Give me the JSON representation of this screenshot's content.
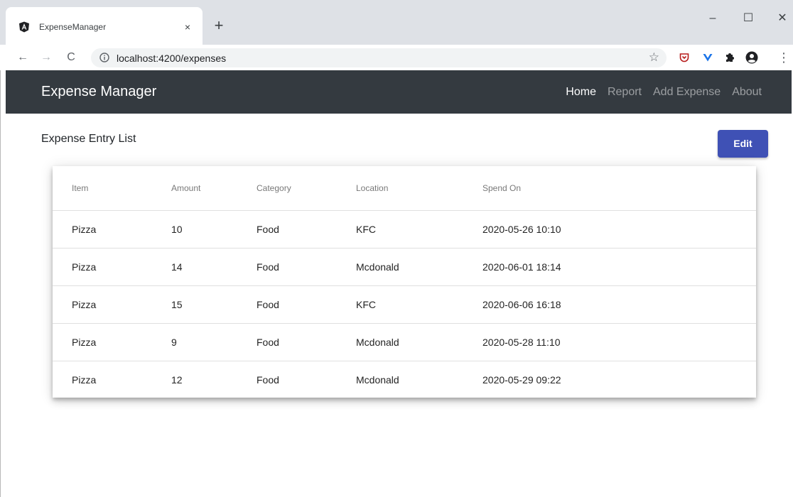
{
  "browser": {
    "tab_title": "ExpenseManager",
    "tab_close_glyph": "×",
    "new_tab_glyph": "+",
    "url": "localhost:4200/expenses",
    "window_controls": {
      "minimize": "–",
      "maximize": "☐",
      "close": "✕"
    },
    "nav": {
      "back": "←",
      "forward": "→",
      "reload": "C"
    },
    "star_glyph": "☆",
    "extensions": [
      "pocket-icon",
      "vue-devtools-icon",
      "puzzle-icon",
      "profile-icon",
      "more-icon"
    ],
    "more_glyph": "⋮"
  },
  "navbar": {
    "brand": "Expense Manager",
    "links": [
      {
        "label": "Home",
        "active": true
      },
      {
        "label": "Report",
        "active": false
      },
      {
        "label": "Add Expense",
        "active": false
      },
      {
        "label": "About",
        "active": false
      }
    ]
  },
  "content": {
    "heading": "Expense Entry List",
    "edit_button": "Edit"
  },
  "table": {
    "columns": [
      "Item",
      "Amount",
      "Category",
      "Location",
      "Spend On"
    ],
    "rows": [
      [
        "Pizza",
        "10",
        "Food",
        "KFC",
        "2020-05-26 10:10"
      ],
      [
        "Pizza",
        "14",
        "Food",
        "Mcdonald",
        "2020-06-01 18:14"
      ],
      [
        "Pizza",
        "15",
        "Food",
        "KFC",
        "2020-06-06 16:18"
      ],
      [
        "Pizza",
        "9",
        "Food",
        "Mcdonald",
        "2020-05-28 11:10"
      ],
      [
        "Pizza",
        "12",
        "Food",
        "Mcdonald",
        "2020-05-29 09:22"
      ]
    ]
  },
  "colors": {
    "navbar_bg": "#343a40",
    "edit_button_bg": "#3f51b5",
    "chrome_bg": "#dee1e6"
  }
}
